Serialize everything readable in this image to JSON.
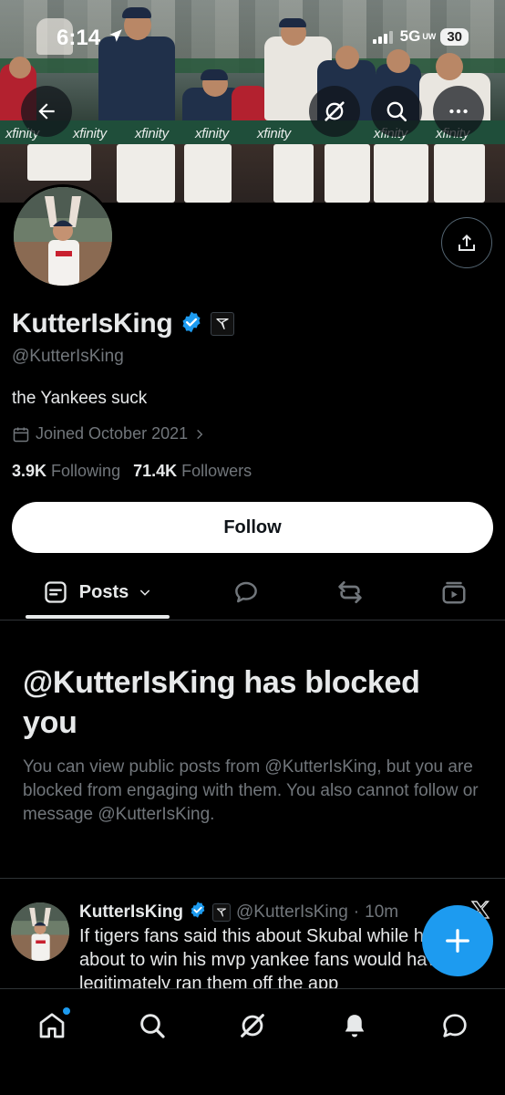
{
  "status_bar": {
    "time": "6:14",
    "network": "5G",
    "network_suffix": "UW",
    "battery": "30"
  },
  "banner": {
    "ads": [
      "xfinity",
      "xfinity",
      "xfinity",
      "xfinity",
      "xfinity",
      "xfinity",
      "xfinity"
    ]
  },
  "top_actions": {
    "back_icon": "arrow-left-icon",
    "grok_icon": "grok-icon",
    "search_icon": "search-icon",
    "more_icon": "more-horizontal-icon",
    "share_icon": "share-icon"
  },
  "profile": {
    "display_name": "KutterIsKing",
    "handle": "@KutterIsKing",
    "bio": "the Yankees suck",
    "joined": "Joined October 2021",
    "following_count": "3.9K",
    "following_label": "Following",
    "followers_count": "71.4K",
    "followers_label": "Followers",
    "verified_color": "#1d9bf0"
  },
  "follow_button": {
    "label": "Follow"
  },
  "tabs": {
    "active_label": "Posts",
    "items": [
      "posts-icon",
      "replies-icon",
      "reposts-icon",
      "media-icon"
    ]
  },
  "blocked": {
    "title": "@KutterIsKing has blocked you",
    "body": "You can view public posts from @KutterIsKing, but you are blocked from engaging with them. You also cannot follow or message @KutterIsKing."
  },
  "post": {
    "name": "KutterIsKing",
    "handle": "@KutterIsKing",
    "separator": "·",
    "time": "10m",
    "text": "If tigers fans said this about Skubal while he was about to win his mvp yankee fans would have legitimately ran them off the app"
  },
  "colors": {
    "accent": "#1d9bf0",
    "background": "#000000",
    "text_primary": "#e7e9ea",
    "text_secondary": "#71767b",
    "border": "#2f3336"
  },
  "bottom_nav": [
    "home-icon",
    "search-icon",
    "grok-icon",
    "notifications-icon",
    "messages-icon"
  ]
}
